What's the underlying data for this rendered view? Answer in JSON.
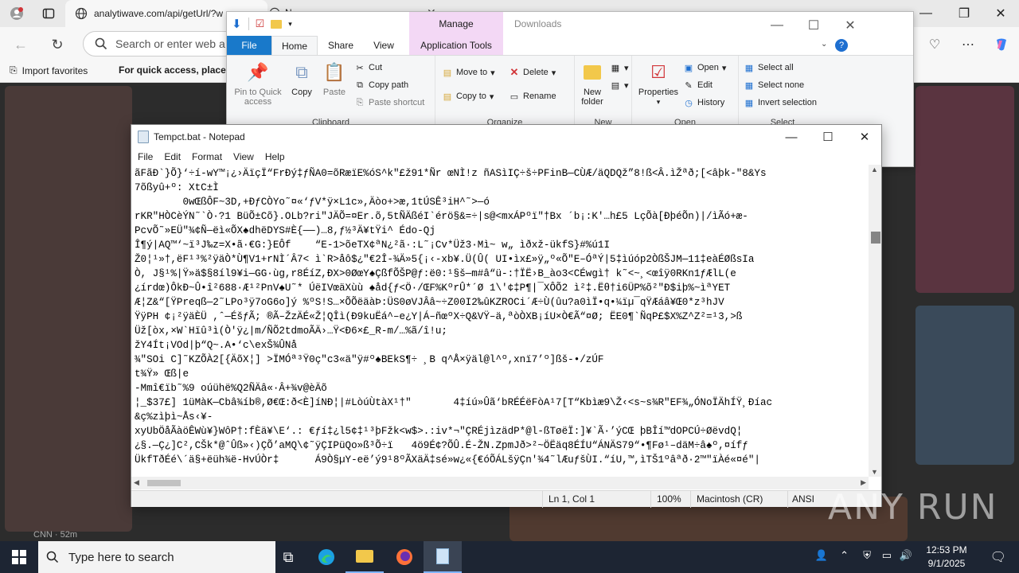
{
  "browser": {
    "tab": {
      "url_text": "analytiwave.com/api/getUrl/?w",
      "second_tab_text": "N"
    },
    "address_placeholder": "Search or enter web a",
    "favorites": {
      "import_label": "Import favorites",
      "hint": "For quick access, place y"
    },
    "cnn_label": "CNN · 52m"
  },
  "explorer": {
    "title": "Downloads",
    "manage_label": "Manage",
    "tabs": {
      "file": "File",
      "home": "Home",
      "share": "Share",
      "view": "View",
      "app_tools": "Application Tools"
    },
    "clipboard": {
      "label": "Clipboard",
      "pin": "Pin to Quick access",
      "copy": "Copy",
      "paste": "Paste",
      "cut": "Cut",
      "copy_path": "Copy path",
      "paste_shortcut": "Paste shortcut"
    },
    "organize": {
      "label": "Organize",
      "move_to": "Move to",
      "copy_to": "Copy to",
      "delete": "Delete",
      "rename": "Rename"
    },
    "new": {
      "label": "New",
      "new_folder": "New folder"
    },
    "open": {
      "label": "Open",
      "properties": "Properties",
      "open": "Open",
      "edit": "Edit",
      "history": "History"
    },
    "select": {
      "label": "Select",
      "select_all": "Select all",
      "select_none": "Select none",
      "invert": "Invert selection"
    }
  },
  "notepad": {
    "title": "Tempct.bat - Notepad",
    "menu": [
      "File",
      "Edit",
      "Format",
      "View",
      "Help"
    ],
    "lines": [
      "ãFãÐ`}Õ}‘÷í-wY™¡¿›ÄïçÏ“FrÐý‡ƒÑA0=õRæïE%óS^k\"£ž91*Ñr œNÌ!z ñASìIÇ÷š÷PFinB—CÙÆ/äQDQž”8!ß<Â.ìŽªð;[<âþk-\"8&Ys",
      "7õßyû+º: XtC±Ì",
      "        0wŒßÔF~3D,+ÐƒCÒYo˜¤«‘ƒV*ÿ×L1c»,Äòo+>æ,1tÚSÊ³iH^˜>—ó",
      "rKR\"HÒCèÝN˜`Ò·?1 BüÕ±Cõ}.OLb?ri\"JÄÕ=¤Er.õ,5tÑÄßéI`érö§&=÷|s@<mxÁPºï\"†Bx ´b¡:K'…h£5 LçÕà[ÐþéÕn)|/ìÃó+æ-",
      "PcvÕ˜»EÜ\"¾¢Ñ—ëì«ÕX♠dhëDYS#È{——)…8,ƒ½³Ä¥tŸi^ Édo-Qj",
      "Î¶ý|AQ™‘~ï³J‰z=X•ã·€G:}EÔf    “E‑1>õeTX¢ªN¿²ã·:L˜¡Cv*Üž3·Mì~ w„ ìðxž-ükfS}#%ú1I",
      "Ž0¦¹»†,ëF¹³%²ÿäÒ*Ù¶V1+rNÌ´Â7< ì`R>åô$¿\"€2Î-¾Ä»5{¡‹-xb¥.Ü(Û( UI•ìx£»ÿ„º«Õ\"E–ÓªÝ|5‡ìúóp2ÒßŠJM—11‡eàÉØßsIa",
      "Ò, J§¹%|Ÿ»ä$§8íl9¥i—GG·ùg,r8ÉíZ,ÐX>0ØœY♠ÇßfÕŠP@ƒ:ë0:¹§š—m#â“ü-:†ÏË›B_ào3<CÉwgì† k˜<~¸<œîÿ0RKn1ƒÆlL(e",
      "¿írdœ)ÔkÐ~Û•î²688·Æ¹²PnV♠U˜* ÚëIVœäXùù ♠åd{ƒ<Ö·/ŒF%KºrÛ*´Ø 1\\'¢‡P¶|¯XÔÕ2 ì²‡.Ëθ†i6ÜP%õ²\"Ð$iþ%~ìªYET",
      "Æ¦Z&“[ŸPreqß—2˜LPo³ÿ7oG6o]ý %ºS!S…×ÕÕëäàÞ:ÜS0øVJÂâ~÷Z00I2‰ûKZROCi´Æ÷Ù(ûu?a0ìÏ•q•¼ïµ¯qŸÆáâ¥Œ0*z³hJV",
      "ŸÿPH ¢¡²ÿäÈÜ ,ˆ—ÉšƒÃ; ®Ã–ŽzÄÉ«Ž¦QÎì(Ð9kuËá^–e¿Y|Á–ñœºX÷Q&VŸ–ä,ªòÒXB¡íU×Ò€Ã“¤Ø; ËE0¶`ÑqP£$X%Z^Z²=¹3,>ß",
      "Üž[òx,×W`Hïû³ì(Ò'ÿ¿|m/ÑÕ2tdmoÃÄ›…Ÿ<Ð6×£_R-m/…%ã/î!u;",
      "žY4Ít¡VOd|þ“Q~.A•‘c\\exŠ¾ÛNå",
      "¾\"SOi C]˜KZÕÀ2[{ÄõX¦] >ÏMÓª³Ÿ0ç\"c3«ä\"ÿ#º♠BEkS¶÷ ¸B q^Å×ÿäl@l^º,xnï7’º]ßš-•/zÚF",
      "t¾Ÿ» Œß|e",
      "-Mmî€ïb˜%9 oúühë%Q2ÑÄâ«·Â+¾v@èÄõ",
      "¦_$37£] 1üMàK—Cbâ¾íb®,Ø€Œ:ð<È]íNÐ¦|#LòúÙtàX¹†\"       4‡íú»Ûã‘bRÉÉëFòA¹7[T“Kbìæ9\\Ž‹<s~s¾R\"EF¾„ÓNoÏÄhÍŸ¸Ðíac",
      "&ç%zìþì~Ås‹¥-",
      "xyUbÖåÃàöÊWù¥}WôP†:fÈä¥\\E‘.: €ƒí‡¿l5¢‡¹³þFžk<w$>.:iv*¬\"ÇRÉjìzädP*@l-ßTøëÏ:]¥`Ã·’ýCŒ þBÎí™dOPCÚ÷ØëvdQ¦",
      "¿§.—Ç¿]C²,CŠk*@ˆÛß»‹)ÇÕ’aMQ\\¢˜ÿÇIPüQo»ß³Õ÷ï   4ö9É¢?ÕÛ.É-ŽN.ZpmJð>²~ÖËäq8ÉÍU“ÁNÄS79“•¶Fø¹–däM÷â♠º,¤ífƒ",
      "ÜkfTðÉé\\´ä§+ëüh¾ë-HvÚÒr‡      Á9Ò§µY-eë’ý9¹8ºÃXäÄ‡sé»w¿«{€óÕÁLšÿÇn'¾4˜lÆuƒšÙI.“íU,™,ìTŠ1ºâªð·2™\"ïÀé«¤é\"|"
    ],
    "status": {
      "position": "Ln 1, Col 1",
      "zoom": "100%",
      "line_ending": "Macintosh (CR)",
      "encoding": "ANSI"
    }
  },
  "taskbar": {
    "search_placeholder": "Type here to search",
    "time": "12:53 PM",
    "date": "9/1/2025"
  },
  "watermark": "ANY RUN"
}
